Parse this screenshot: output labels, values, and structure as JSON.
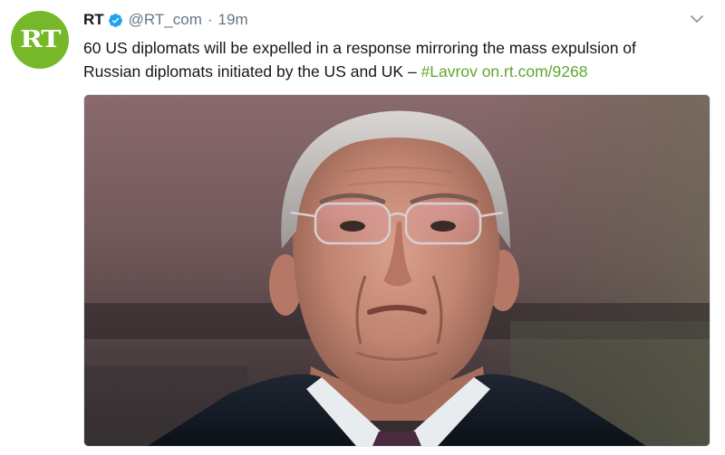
{
  "account": {
    "avatar_text": "RT",
    "display_name": "RT",
    "handle": "@RT_com",
    "separator": "·",
    "time": "19m",
    "verified": true,
    "avatar_color": "#77b82a"
  },
  "tweet": {
    "line1": "60 US diplomats will be expelled in a response mirroring the mass expulsion of",
    "line2_text": "Russian diplomats initiated by the US and UK – ",
    "hashtag": "#Lavrov",
    "link": "on.rt.com/9268",
    "link_color": "#5ea82f"
  },
  "media": {
    "icon": "photo-of-man-in-glasses"
  },
  "icons": {
    "verified": "verified-badge-icon",
    "menu": "chevron-down-icon"
  }
}
